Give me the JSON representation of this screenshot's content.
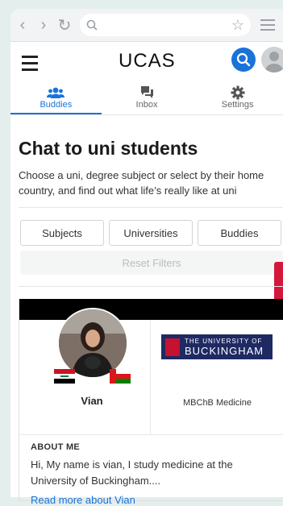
{
  "browser": {
    "back_icon": "chevron-left-icon",
    "forward_icon": "chevron-right-icon",
    "reload_icon": "reload-icon",
    "search_icon": "search-icon",
    "bookmark_icon": "star-icon",
    "menu_icon": "menu-icon"
  },
  "header": {
    "logo": "UCAS",
    "menu_icon": "hamburger-icon",
    "search_icon": "search-icon",
    "avatar_icon": "user-avatar-icon",
    "accent": "#1a73d9"
  },
  "tabs": [
    {
      "label": "Buddies",
      "icon": "people-icon",
      "active": true
    },
    {
      "label": "Inbox",
      "icon": "chat-icon",
      "active": false
    },
    {
      "label": "Settings",
      "icon": "gear-icon",
      "active": false
    }
  ],
  "main": {
    "title": "Chat to uni students",
    "intro": "Choose a uni, degree subject or select by their home country, and find out what life’s really like at uni"
  },
  "filters": {
    "subjects": "Subjects",
    "universities": "Universities",
    "buddies": "Buddies",
    "reset": "Reset Filters"
  },
  "card": {
    "name": "Vian",
    "flags": [
      "iraq-flag-icon",
      "oman-flag-icon"
    ],
    "university_logo_line1": "THE UNIVERSITY OF",
    "university_logo_line2": "BUCKINGHAM",
    "course": "MBChB Medicine",
    "about_heading": "ABOUT ME",
    "bio": "Hi, My name is vian, I study medicine at the University of Buckingham....",
    "read_more": "Read more about Vian"
  }
}
